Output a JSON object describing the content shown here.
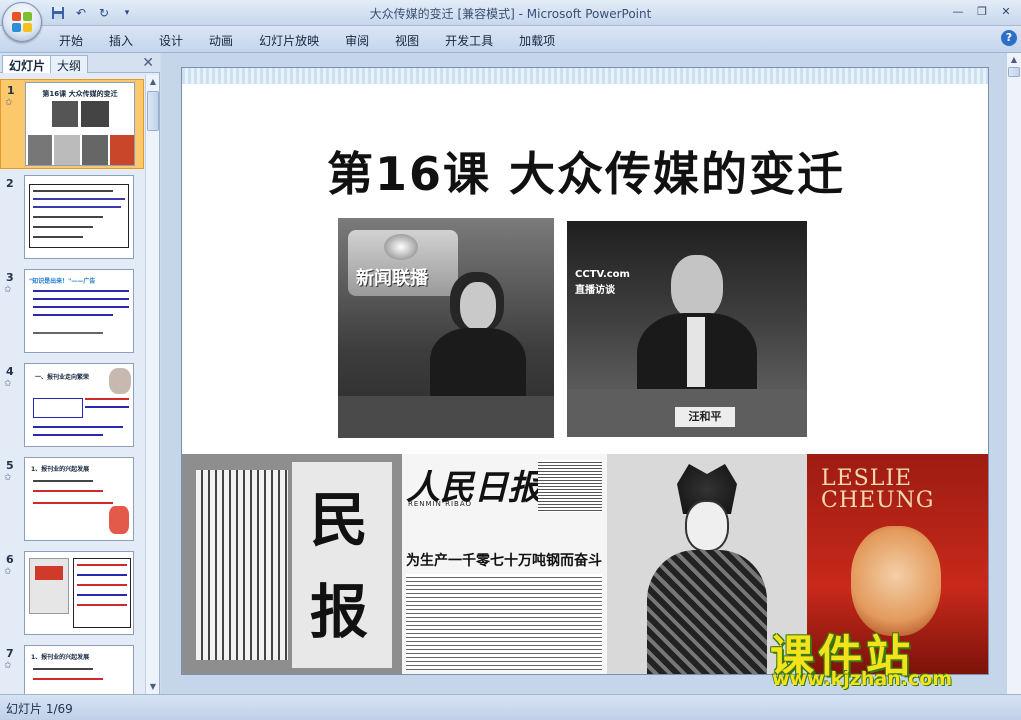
{
  "window": {
    "title": "大众传媒的变迁 [兼容模式] - Microsoft PowerPoint",
    "controls": [
      "minimize-icon",
      "restore-icon",
      "close-icon"
    ]
  },
  "quick_access": [
    "save-icon",
    "undo-icon",
    "redo-icon",
    "customize-qat-icon"
  ],
  "ribbon": {
    "tabs": [
      "开始",
      "插入",
      "设计",
      "动画",
      "幻灯片放映",
      "审阅",
      "视图",
      "开发工具",
      "加载项"
    ],
    "help_icon": "help-icon"
  },
  "left_panel": {
    "tabs": {
      "slides": "幻灯片",
      "outline": "大纲"
    },
    "selected_slide": 1,
    "thumbnails": [
      {
        "num": "1",
        "title": "第16课 大众传媒的变迁"
      },
      {
        "num": "2",
        "title": ""
      },
      {
        "num": "3",
        "title": "\"知识是出来！\"——广告"
      },
      {
        "num": "4",
        "title": "一、报刊业走向繁荣"
      },
      {
        "num": "5",
        "title": "1、报刊业的兴起发展"
      },
      {
        "num": "6",
        "title": ""
      },
      {
        "num": "7",
        "title": "1、报刊业的兴起发展"
      }
    ]
  },
  "slide": {
    "title": "第16课  大众传媒的变迁",
    "photos": [
      {
        "name": "news-anchor-photo",
        "caption": "新闻联播"
      },
      {
        "name": "cctv-interview-photo",
        "caption": "CCTV.com 直播访谈",
        "nameplate": "汪和平"
      },
      {
        "name": "minbao-newspaper-photo",
        "caption": "民报"
      },
      {
        "name": "peoples-daily-photo",
        "caption": "人民日报",
        "pinyin": "RENMIN RIBAO",
        "headline": "为生产一千零七十万吨钢而奋斗"
      },
      {
        "name": "opera-performer-photo",
        "caption": ""
      },
      {
        "name": "leslie-cheung-album-photo",
        "caption": "LESLIE CHEUNG"
      }
    ]
  },
  "watermark": {
    "text": "课件站",
    "url": "www.kjzhan.com"
  },
  "status": {
    "slide_counter": "幻灯片 1/69"
  }
}
